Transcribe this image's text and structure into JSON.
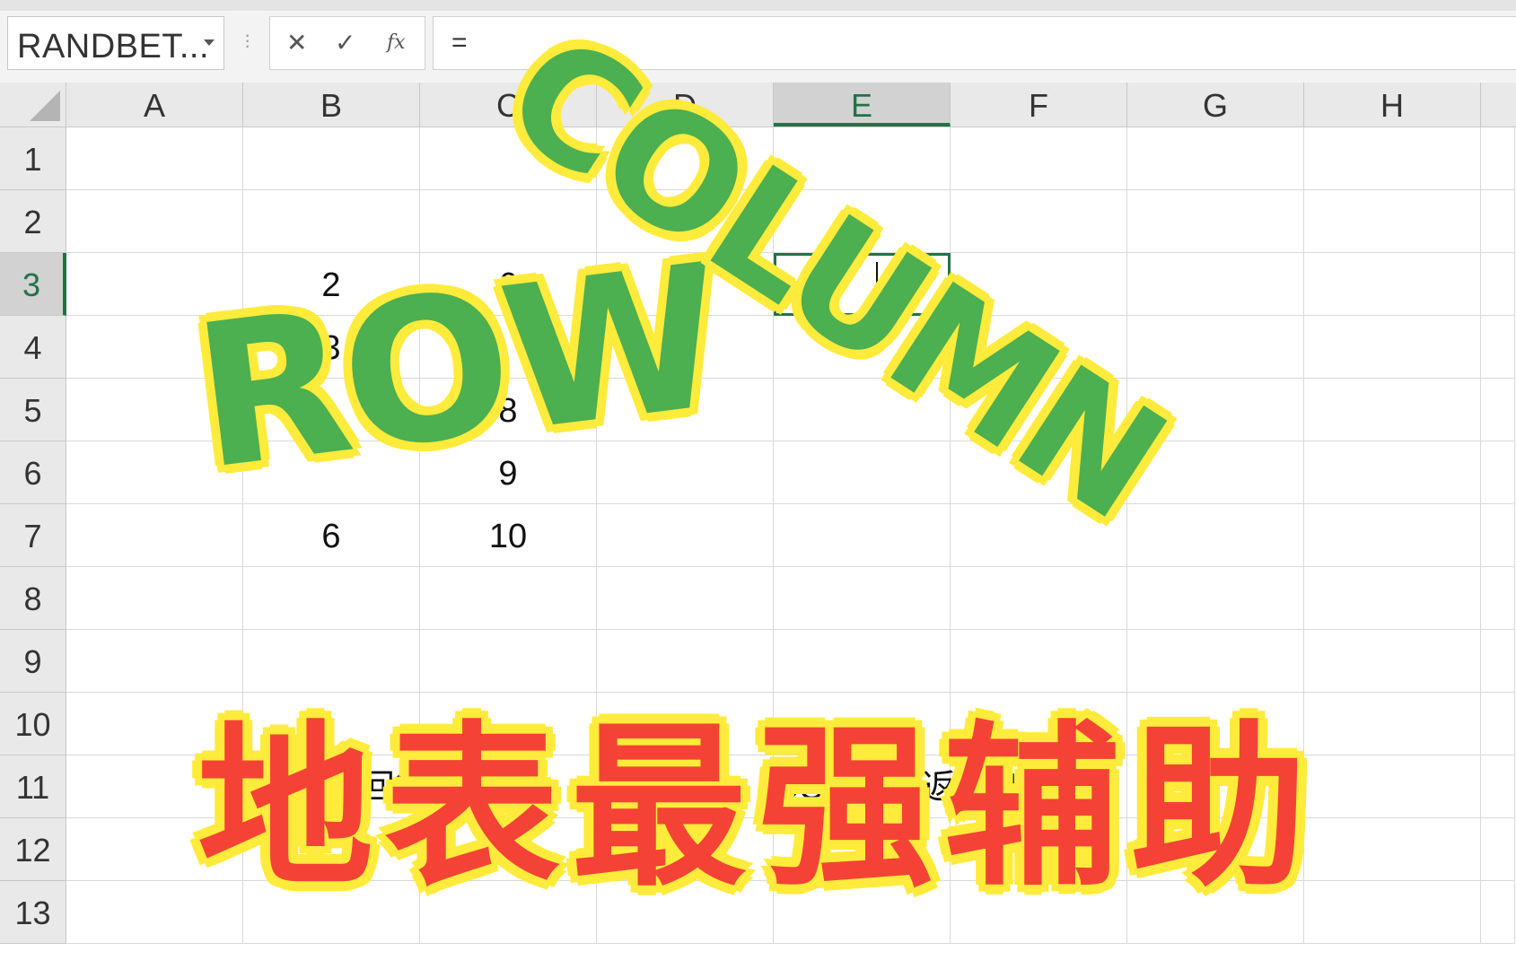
{
  "formula_bar": {
    "name_box": "RANDBET...",
    "cancel_glyph": "✕",
    "enter_glyph": "✓",
    "insert_function_glyph": "fx",
    "formula": "="
  },
  "columns": [
    "A",
    "B",
    "C",
    "D",
    "E",
    "F",
    "G",
    "H"
  ],
  "selected_column": "E",
  "rows": [
    "1",
    "2",
    "3",
    "4",
    "5",
    "6",
    "7",
    "8",
    "9",
    "10",
    "11",
    "12",
    "13"
  ],
  "selected_row": "3",
  "cells": {
    "B3": "2",
    "B4": "3",
    "B7": "6",
    "C3": "6",
    "C5": "8",
    "C6": "9",
    "C7": "10",
    "B11": "ROW返回行",
    "E11": "COLUMN返回列"
  },
  "overlay": {
    "row_word": "ROW",
    "column_word": "COLUMN",
    "title": "地表最强辅助"
  },
  "colors": {
    "accent": "#217346",
    "overlay_green": "#4caf50",
    "overlay_yellow": "#ffeb3b",
    "overlay_red": "#f44336"
  }
}
